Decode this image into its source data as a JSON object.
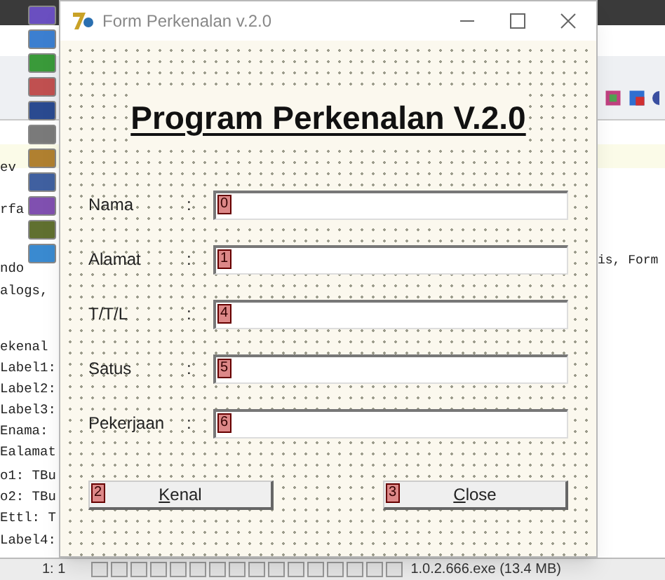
{
  "editor": {
    "code_lines": [
      "ev",
      "rfa",
      "ndo",
      "alogs,",
      "ekenal",
      "Label1:",
      "Label2:",
      "Label3:",
      "Enama:",
      "Ealamat",
      "o1: TBu",
      "o2: TBu",
      "Ettl: T",
      "Label4:"
    ],
    "code_right": "is, Form",
    "status_position": "1:  1",
    "status_file": "1.0.2.666.exe (13.4 MB)"
  },
  "window": {
    "title": "Form Perkenalan v.2.0"
  },
  "heading": "Program Perkenalan V.2.0",
  "fields": [
    {
      "label": "Nama",
      "colon": ":",
      "tab_order": "0"
    },
    {
      "label": "Alamat",
      "colon": ":",
      "tab_order": "1"
    },
    {
      "label": "T/T/L",
      "colon": ":",
      "tab_order": "4"
    },
    {
      "label": "Satus",
      "colon": ":",
      "tab_order": "5"
    },
    {
      "label": "Pekerjaan",
      "colon": ":",
      "tab_order": "6"
    }
  ],
  "buttons": [
    {
      "label": "Kenal",
      "tab_order": "2",
      "mnemonic": true
    },
    {
      "label": "Close",
      "tab_order": "3",
      "mnemonic": true
    }
  ]
}
